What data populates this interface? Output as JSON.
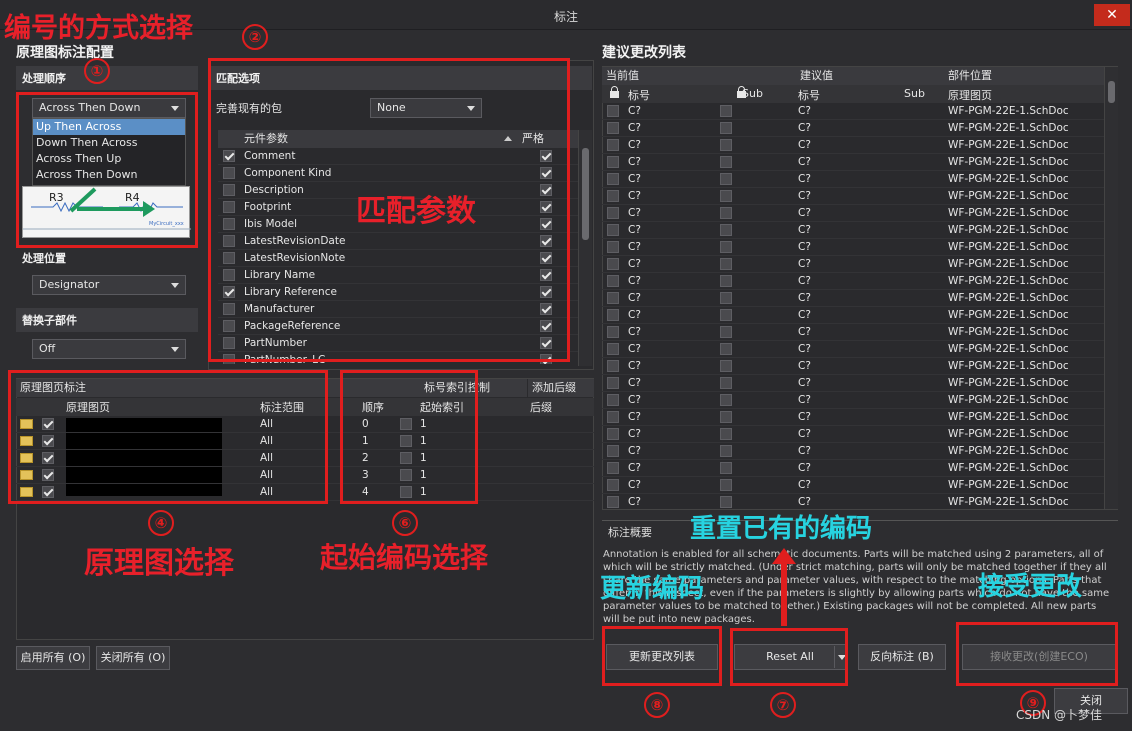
{
  "window": {
    "title": "标注",
    "close_glyph": "✕"
  },
  "left": {
    "title": "原理图标注配置",
    "order": {
      "label": "处理顺序",
      "selected": "Across Then Down",
      "options": [
        "Up Then Across",
        "Down Then Across",
        "Across Then Up",
        "Across Then Down"
      ],
      "preview_labels": [
        "R3",
        "R4"
      ],
      "preview_caption": "MyCircuit_xxx"
    },
    "location": {
      "label": "处理位置",
      "selected": "Designator"
    },
    "replace": {
      "label": "替换子部件",
      "selected": "Off"
    },
    "sheets": {
      "group_header": "原理图页标注",
      "col_sheet": "原理图页",
      "col_scope": "标注范围",
      "rows": [
        {
          "checked": true,
          "scope": "All"
        },
        {
          "checked": true,
          "scope": "All"
        },
        {
          "checked": true,
          "scope": "All"
        },
        {
          "checked": true,
          "scope": "All"
        },
        {
          "checked": true,
          "scope": "All"
        }
      ]
    },
    "index": {
      "group_header": "标号索引控制",
      "col_order": "顺序",
      "col_start": "起始索引",
      "rows": [
        {
          "order": "0",
          "start": "1"
        },
        {
          "order": "1",
          "start": "1"
        },
        {
          "order": "2",
          "start": "1"
        },
        {
          "order": "3",
          "start": "1"
        },
        {
          "order": "4",
          "start": "1"
        }
      ]
    },
    "suffix": {
      "group_header": "添加后缀",
      "col": "后缀"
    },
    "enable_all": "启用所有 (O)",
    "disable_all": "关闭所有 (O)"
  },
  "match": {
    "title": "匹配选项",
    "complete_label": "完善现有的包",
    "complete_value": "None",
    "col_param": "元件参数",
    "col_strict": "严格",
    "params": [
      {
        "name": "Comment",
        "checked": true,
        "strict": true
      },
      {
        "name": "Component Kind",
        "checked": false,
        "strict": true
      },
      {
        "name": "Description",
        "checked": false,
        "strict": true
      },
      {
        "name": "Footprint",
        "checked": false,
        "strict": true
      },
      {
        "name": "Ibis Model",
        "checked": false,
        "strict": true
      },
      {
        "name": "LatestRevisionDate",
        "checked": false,
        "strict": true
      },
      {
        "name": "LatestRevisionNote",
        "checked": false,
        "strict": true
      },
      {
        "name": "Library Name",
        "checked": false,
        "strict": true
      },
      {
        "name": "Library Reference",
        "checked": true,
        "strict": true
      },
      {
        "name": "Manufacturer",
        "checked": false,
        "strict": true
      },
      {
        "name": "PackageReference",
        "checked": false,
        "strict": true
      },
      {
        "name": "PartNumber",
        "checked": false,
        "strict": true
      },
      {
        "name": "PartNumber_LC",
        "checked": false,
        "strict": true
      }
    ]
  },
  "right": {
    "title": "建议更改列表",
    "group_current": "当前值",
    "group_proposed": "建议值",
    "group_location": "部件位置",
    "col_designator": "标号",
    "col_sub": "Sub",
    "col_proposed_designator": "标号",
    "col_proposed_sub": "Sub",
    "col_sheet": "原理图页",
    "row_designator": "C?",
    "row_proposed": "C?",
    "row_sheet": "WF-PGM-22E-1.SchDoc",
    "row_count": 24,
    "summary_title": "标注概要",
    "summary_text": "Annotation is enabled for all schematic documents. Parts will be matched using 2 parameters, all of which will be strictly matched. (Under strict matching, parts will only be matched together if they all share the same parameters and parameter values, with respect to the matching options. Parts that differ in this respect, even if the parameters is slightly by allowing parts which do not have the same parameter values to be matched together.) Existing packages will not be completed. All new parts will be put into new packages.",
    "btn_update": "更新更改列表",
    "btn_reset": "Reset All",
    "btn_back": "反向标注 (B)",
    "btn_accept": "接收更改(创建ECO)",
    "btn_close": "关闭"
  },
  "annotations": {
    "top_title": "编号的方式选择",
    "match_params": "匹配参数",
    "sheet_select": "原理图选择",
    "start_select": "起始编码选择",
    "reset_existing": "重置已有的编码",
    "update_codes": "更新编码",
    "accept_changes": "接受更改",
    "n1": "①",
    "n2": "②",
    "n4": "④",
    "n6": "⑥",
    "n7": "⑦",
    "n8": "⑧",
    "n9": "⑨"
  },
  "watermark": "CSDN @卜梦佳"
}
